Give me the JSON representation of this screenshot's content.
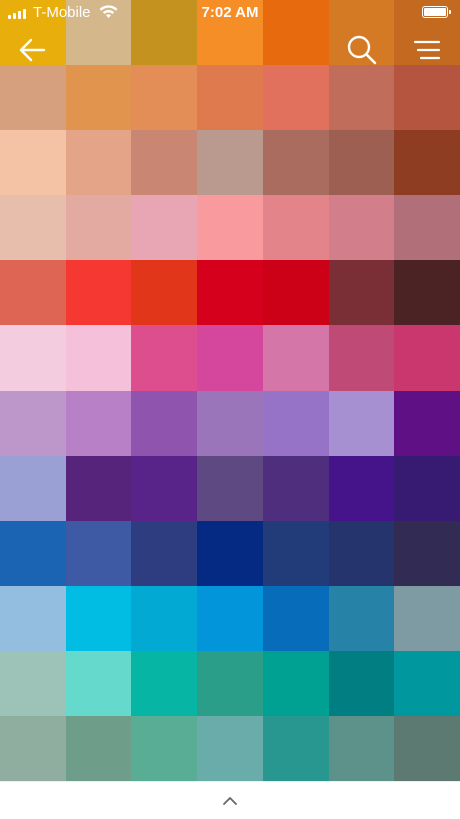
{
  "status_bar": {
    "carrier": "T-Mobile",
    "time": "7:02 AM"
  },
  "icons": {
    "back": "arrow-left-icon",
    "search": "search-icon",
    "menu": "menu-icon",
    "expand": "chevron-up-icon"
  },
  "swatches": [
    [
      "#E8AE0C",
      "#D4B88C",
      "#C4921E",
      "#F68E28",
      "#E76A0E",
      "#D57A24",
      "#C46A20"
    ],
    [
      "#D6A07E",
      "#E0944E",
      "#E38E56",
      "#DF7A4E",
      "#E1715C",
      "#C06E5B",
      "#B5543F"
    ],
    [
      "#F4C3A6",
      "#E4A487",
      "#C98673",
      "#BA9A8E",
      "#A96C5E",
      "#9D5F52",
      "#8E3D22"
    ],
    [
      "#E6BEAB",
      "#E2AAA0",
      "#E8A5B3",
      "#F99A9F",
      "#E2848A",
      "#D27F8B",
      "#B06F79"
    ],
    [
      "#DE6453",
      "#F53932",
      "#E1361A",
      "#D5001C",
      "#CC0016",
      "#7A2E35",
      "#4B2325"
    ],
    [
      "#F3CDDF",
      "#F5C1DA",
      "#DC4E8E",
      "#D4479D",
      "#D576A8",
      "#BF4A75",
      "#CA376E"
    ],
    [
      "#BD97C9",
      "#B880C7",
      "#8F55AE",
      "#9A75B9",
      "#9773C7",
      "#A690D2",
      "#5E1084"
    ],
    [
      "#9AA0D3",
      "#56247B",
      "#59248A",
      "#5F4983",
      "#4F2E7E",
      "#45148A",
      "#371B72"
    ],
    [
      "#1B63B3",
      "#3F5AA5",
      "#2D3D7F",
      "#052A84",
      "#213C78",
      "#25346D",
      "#322B53"
    ],
    [
      "#93BEE0",
      "#01BCE3",
      "#02A9D2",
      "#0395DA",
      "#076DBB",
      "#2782A8",
      "#7E9AA3"
    ],
    [
      "#9DC3B8",
      "#65D9CC",
      "#07B5A4",
      "#2B9E8A",
      "#00A092",
      "#007E81",
      "#00979F"
    ],
    [
      "#8FAE9F",
      "#6E9E89",
      "#58AD94",
      "#69ACAA",
      "#279790",
      "#5C9289",
      "#5D7A72"
    ]
  ]
}
